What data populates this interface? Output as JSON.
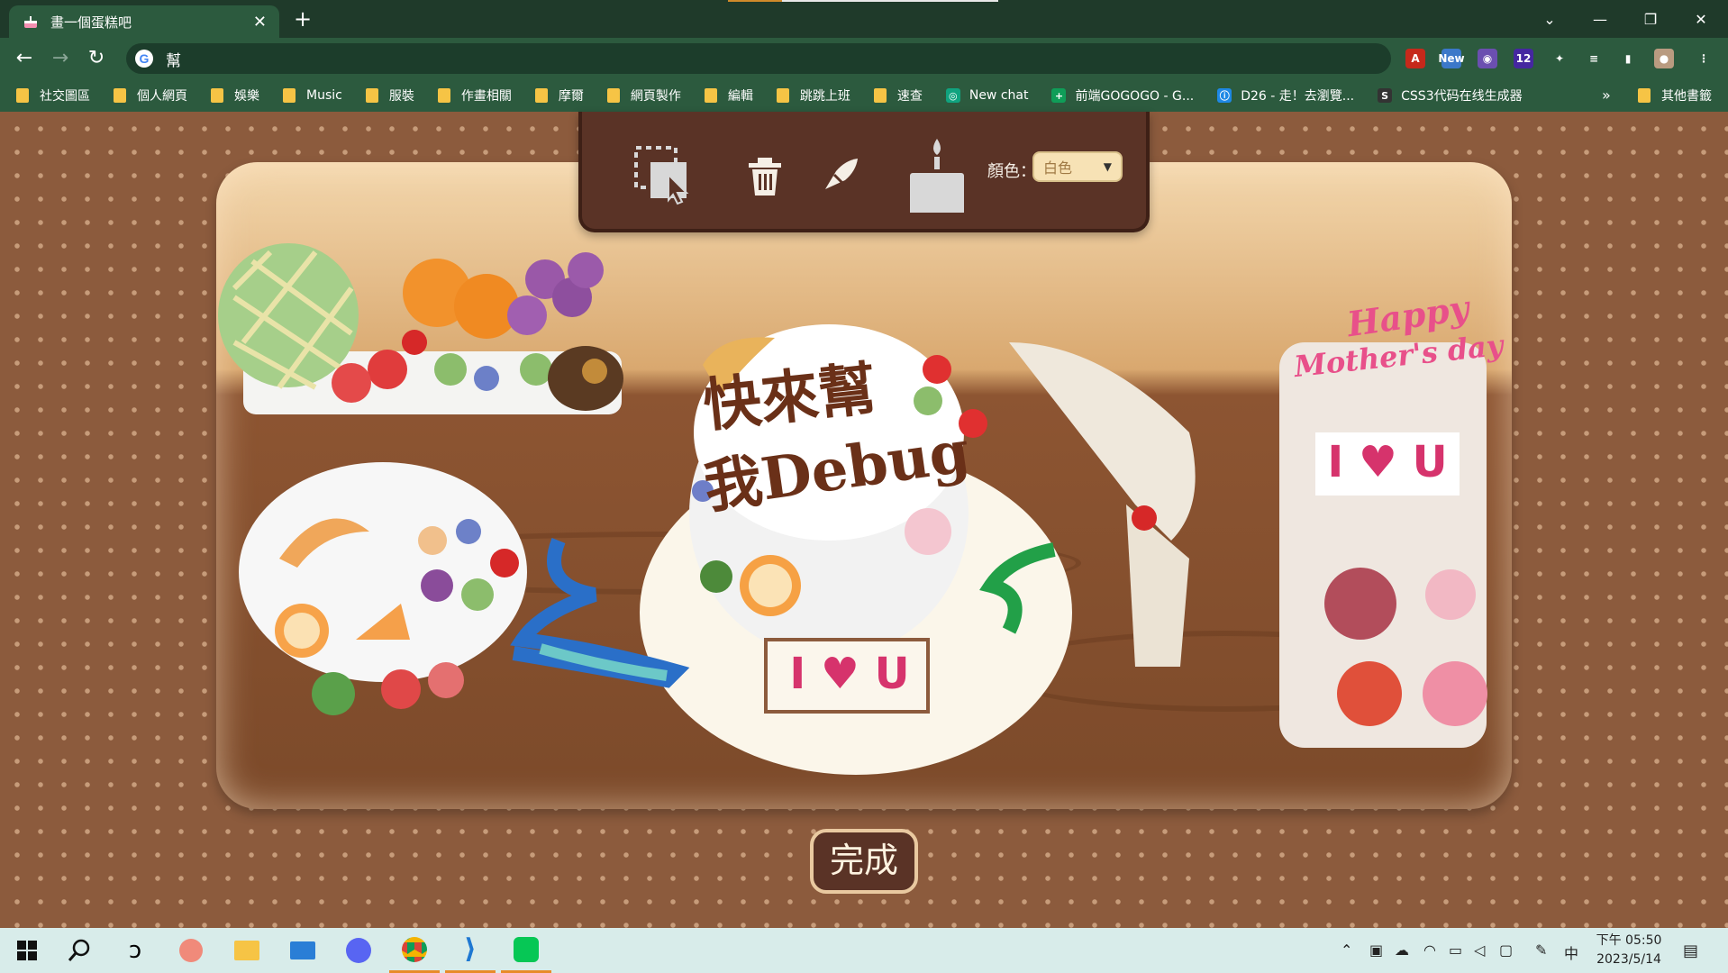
{
  "browser": {
    "tab_title": "畫一個蛋糕吧",
    "tab_close": "✕",
    "new_tab": "+",
    "address": "幫",
    "window_controls": {
      "chevron": "⌄",
      "minimize": "—",
      "restore": "❐",
      "close": "✕"
    },
    "extensions": [
      {
        "name": "pdf-icon",
        "label": "A",
        "color": "#c6291b"
      },
      {
        "name": "new-extension-icon",
        "label": "New",
        "color": "#3b78c9"
      },
      {
        "name": "palette-extension-icon",
        "label": "◉",
        "color": "#6b4fb0"
      },
      {
        "name": "badge-extension-icon",
        "label": "12",
        "color": "#4527a0"
      },
      {
        "name": "puzzle-icon",
        "label": "✦",
        "color": "transparent"
      },
      {
        "name": "media-icon",
        "label": "≡",
        "color": "transparent"
      },
      {
        "name": "side-panel-icon",
        "label": "▮",
        "color": "transparent"
      },
      {
        "name": "profile-avatar",
        "label": "●",
        "color": "#b99b80"
      },
      {
        "name": "more-menu-icon",
        "label": "⋮",
        "color": "transparent"
      }
    ]
  },
  "bookmarks": [
    {
      "label": "社交圖區",
      "type": "folder"
    },
    {
      "label": "個人網頁",
      "type": "folder"
    },
    {
      "label": "娛樂",
      "type": "folder"
    },
    {
      "label": "Music",
      "type": "folder"
    },
    {
      "label": "服裝",
      "type": "folder"
    },
    {
      "label": "作畫相關",
      "type": "folder"
    },
    {
      "label": "摩爾",
      "type": "folder"
    },
    {
      "label": "網頁製作",
      "type": "folder"
    },
    {
      "label": "編輯",
      "type": "folder"
    },
    {
      "label": "跳跳上班",
      "type": "folder"
    },
    {
      "label": "速查",
      "type": "folder"
    },
    {
      "label": "New chat",
      "type": "site",
      "color": "#10a37f",
      "glyph": "◎"
    },
    {
      "label": "前端GOGOGO - G...",
      "type": "site",
      "color": "#0f9d58",
      "glyph": "+"
    },
    {
      "label": "D26 - 走！去瀏覽...",
      "type": "site",
      "color": "#1e88e5",
      "glyph": "ⓘ"
    },
    {
      "label": "CSS3代码在线生成器",
      "type": "site",
      "color": "#333333",
      "glyph": "S"
    }
  ],
  "bookmarks_more": "»",
  "bookmarks_other": "其他書籤",
  "app": {
    "color_label": "顏色：",
    "color_value": "白色",
    "done_label": "完成",
    "cake_text_line1": "快來幫",
    "cake_text_line2": "我Debug",
    "sign_text": "I ♥ U",
    "card_title_line1": "Happy",
    "card_title_line2": "Mother's day",
    "colors": {
      "panel": "#5a3326",
      "board_top": "#f3d7ad",
      "table": "#7c4a2a",
      "background": "#8c5b3d"
    }
  },
  "taskbar": {
    "clock_period_time": "下午 05:50",
    "clock_date": "2023/5/14",
    "ime": "中"
  }
}
